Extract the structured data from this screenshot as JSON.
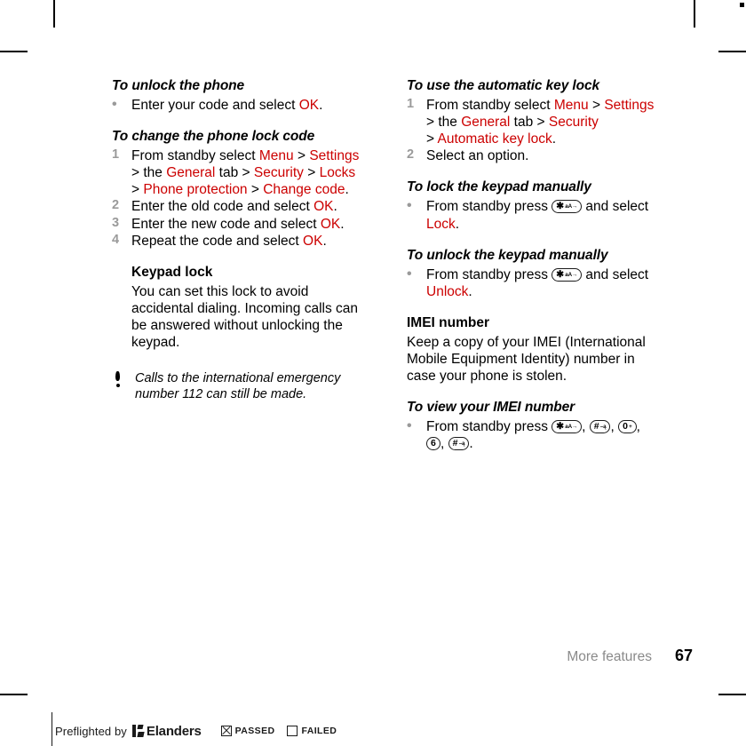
{
  "document": {
    "footer_section": "More features",
    "page_number": "67"
  },
  "colors": {
    "highlight": "#cc0000",
    "marker": "#9a9a9a",
    "footer_section": "#8a8a8a"
  },
  "keys": {
    "star": {
      "main": "✱",
      "sub": "aA→"
    },
    "hash": {
      "main": "#",
      "sub": "–ą"
    },
    "zero": {
      "main": "0",
      "sub": "+"
    },
    "six": {
      "main": "6",
      "sub": ""
    }
  },
  "left_column": {
    "section_unlock_phone": {
      "heading": "To unlock the phone",
      "steps": [
        {
          "marker": "•",
          "marker_type": "bullet",
          "parts": [
            {
              "t": "Enter your code and select "
            },
            {
              "t": "OK",
              "hl": true
            },
            {
              "t": "."
            }
          ]
        }
      ]
    },
    "section_change_lock_code": {
      "heading": "To change the phone lock code",
      "steps": [
        {
          "marker": "1",
          "marker_type": "num",
          "parts": [
            {
              "t": "From standby select "
            },
            {
              "t": "Menu",
              "hl": true
            },
            {
              "t": " > "
            },
            {
              "t": "Settings",
              "hl": true
            },
            {
              "t": "\n> the "
            },
            {
              "t": "General",
              "hl": true
            },
            {
              "t": " tab > "
            },
            {
              "t": "Security",
              "hl": true
            },
            {
              "t": " > "
            },
            {
              "t": "Locks",
              "hl": true
            },
            {
              "t": "\n> "
            },
            {
              "t": "Phone protection",
              "hl": true
            },
            {
              "t": " > "
            },
            {
              "t": "Change code",
              "hl": true
            },
            {
              "t": "."
            }
          ]
        },
        {
          "marker": "2",
          "marker_type": "num",
          "parts": [
            {
              "t": "Enter the old code and select "
            },
            {
              "t": "OK",
              "hl": true
            },
            {
              "t": "."
            }
          ]
        },
        {
          "marker": "3",
          "marker_type": "num",
          "parts": [
            {
              "t": "Enter the new code and select "
            },
            {
              "t": "OK",
              "hl": true
            },
            {
              "t": "."
            }
          ]
        },
        {
          "marker": "4",
          "marker_type": "num",
          "parts": [
            {
              "t": "Repeat the code and select "
            },
            {
              "t": "OK",
              "hl": true
            },
            {
              "t": "."
            }
          ]
        }
      ]
    },
    "section_keypad_lock": {
      "heading": "Keypad lock",
      "body": "You can set this lock to avoid accidental dialing. Incoming calls can be answered without unlocking the keypad."
    },
    "note": {
      "icon": "exclamation-icon",
      "text": "Calls to the international emergency number 112 can still be made."
    }
  },
  "right_column": {
    "section_automatic_key_lock": {
      "heading": "To use the automatic key lock",
      "steps": [
        {
          "marker": "1",
          "marker_type": "num",
          "parts": [
            {
              "t": "From standby select "
            },
            {
              "t": "Menu",
              "hl": true
            },
            {
              "t": " > "
            },
            {
              "t": "Settings",
              "hl": true
            },
            {
              "t": "\n> the "
            },
            {
              "t": "General",
              "hl": true
            },
            {
              "t": " tab > "
            },
            {
              "t": "Security",
              "hl": true
            },
            {
              "t": "\n> "
            },
            {
              "t": "Automatic key lock",
              "hl": true
            },
            {
              "t": "."
            }
          ]
        },
        {
          "marker": "2",
          "marker_type": "num",
          "parts": [
            {
              "t": "Select an option."
            }
          ]
        }
      ]
    },
    "section_lock_keypad": {
      "heading": "To lock the keypad manually",
      "steps": [
        {
          "marker": "•",
          "marker_type": "bullet",
          "parts": [
            {
              "t": "From standby press "
            },
            {
              "key": "star"
            },
            {
              "t": " and select "
            },
            {
              "t": "Lock",
              "hl": true
            },
            {
              "t": "."
            }
          ]
        }
      ]
    },
    "section_unlock_keypad": {
      "heading": "To unlock the keypad manually",
      "steps": [
        {
          "marker": "•",
          "marker_type": "bullet",
          "parts": [
            {
              "t": "From standby press "
            },
            {
              "key": "star"
            },
            {
              "t": " and select "
            },
            {
              "t": "Unlock",
              "hl": true
            },
            {
              "t": "."
            }
          ]
        }
      ]
    },
    "section_imei": {
      "heading": "IMEI number",
      "body": "Keep a copy of your IMEI (International Mobile Equipment Identity) number in case your phone is stolen."
    },
    "section_view_imei": {
      "heading": "To view your IMEI number",
      "steps": [
        {
          "marker": "•",
          "marker_type": "bullet",
          "parts": [
            {
              "t": "From standby press "
            },
            {
              "key": "star"
            },
            {
              "t": ", "
            },
            {
              "key": "hash"
            },
            {
              "t": ", "
            },
            {
              "key": "zero"
            },
            {
              "t": ",\n"
            },
            {
              "key": "six"
            },
            {
              "t": ", "
            },
            {
              "key": "hash"
            },
            {
              "t": "."
            }
          ]
        }
      ]
    }
  },
  "preflight": {
    "text": "Preflighted by",
    "brand": "Elanders",
    "passed_label": "PASSED",
    "failed_label": "FAILED",
    "passed_checked": true,
    "failed_checked": false
  }
}
